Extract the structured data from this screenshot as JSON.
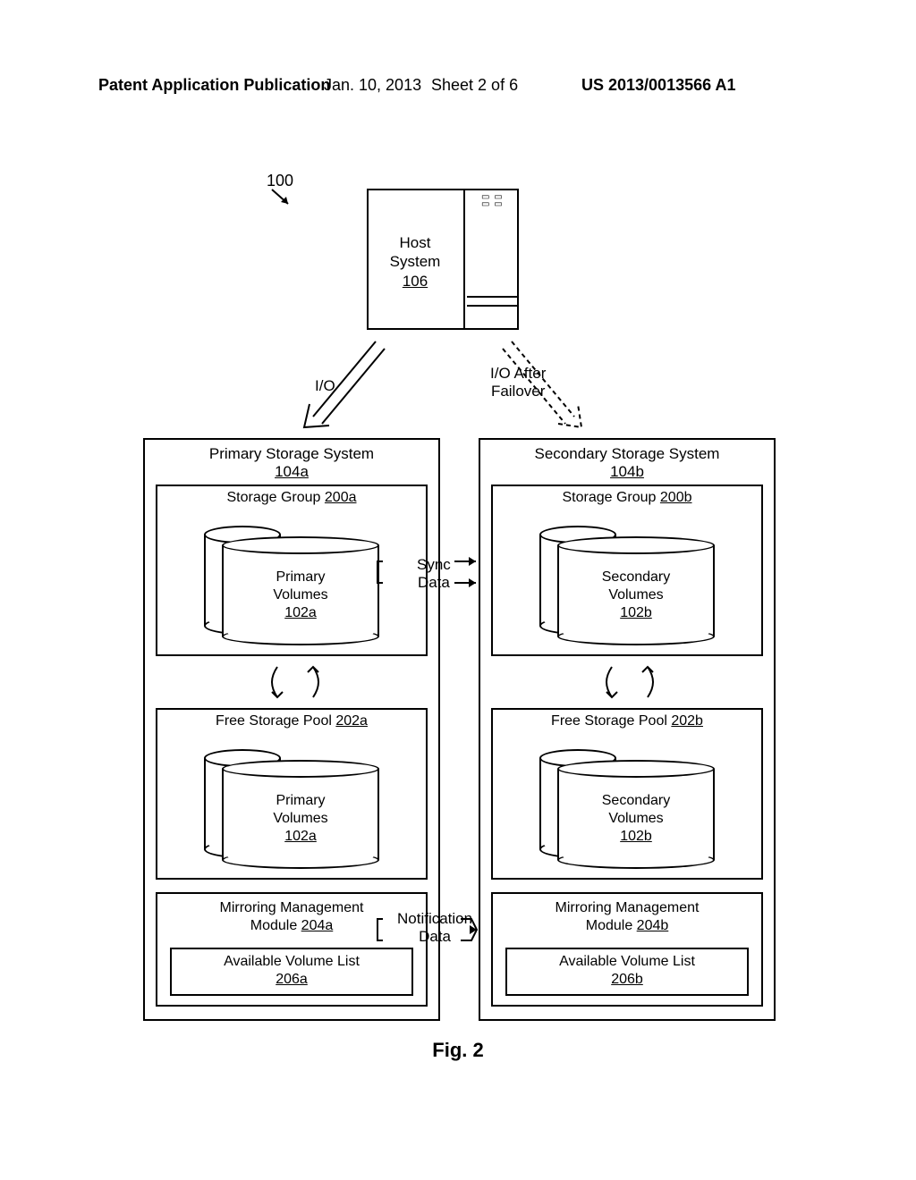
{
  "header": {
    "left": "Patent Application Publication",
    "date": "Jan. 10, 2013",
    "sheet": "Sheet 2 of 6",
    "right": "US 2013/0013566 A1"
  },
  "refs": {
    "fig_ref": "100"
  },
  "host": {
    "label_line1": "Host",
    "label_line2": "System",
    "ref": "106"
  },
  "arrows": {
    "io_left": "I/O",
    "io_right_line1": "I/O After",
    "io_right_line2": "Failover",
    "sync_line1": "Sync",
    "sync_line2": "Data",
    "notif_line1": "Notification",
    "notif_line2": "Data"
  },
  "primary": {
    "title": "Primary Storage System",
    "ref": "104a",
    "group": {
      "title_prefix": "Storage Group",
      "ref": "200a",
      "vol_line1": "Primary",
      "vol_line2": "Volumes",
      "vol_ref": "102a"
    },
    "pool": {
      "title_prefix": "Free Storage Pool",
      "ref": "202a",
      "vol_line1": "Primary",
      "vol_line2": "Volumes",
      "vol_ref": "102a"
    },
    "mgmt": {
      "title_line1": "Mirroring Management",
      "title_line2": "Module",
      "ref": "204a",
      "avl_title": "Available Volume List",
      "avl_ref": "206a"
    }
  },
  "secondary": {
    "title": "Secondary Storage System",
    "ref": "104b",
    "group": {
      "title_prefix": "Storage Group",
      "ref": "200b",
      "vol_line1": "Secondary",
      "vol_line2": "Volumes",
      "vol_ref": "102b"
    },
    "pool": {
      "title_prefix": "Free Storage Pool",
      "ref": "202b",
      "vol_line1": "Secondary",
      "vol_line2": "Volumes",
      "vol_ref": "102b"
    },
    "mgmt": {
      "title_line1": "Mirroring Management",
      "title_line2": "Module",
      "ref": "204b",
      "avl_title": "Available Volume List",
      "avl_ref": "206b"
    }
  },
  "figure_caption": "Fig. 2"
}
